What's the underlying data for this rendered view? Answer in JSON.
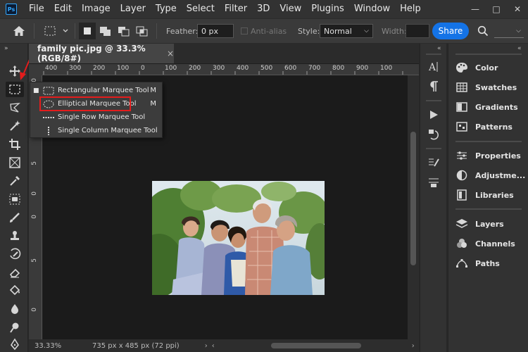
{
  "menubar": {
    "logo": "Ps",
    "items": [
      "File",
      "Edit",
      "Image",
      "Layer",
      "Type",
      "Select",
      "Filter",
      "3D",
      "View",
      "Plugins",
      "Window",
      "Help"
    ]
  },
  "options": {
    "feather_label": "Feather:",
    "feather_value": "0 px",
    "antialias_label": "Anti-alias",
    "style_label": "Style:",
    "style_value": "Normal",
    "width_label": "Width:",
    "share_label": "Share"
  },
  "document": {
    "tab_title": "family pic.jpg @ 33.3% (RGB/8#)",
    "tab_close": "×",
    "ruler_top": [
      "400",
      "300",
      "200",
      "100",
      "0",
      "100",
      "200",
      "300",
      "400",
      "500",
      "600",
      "700",
      "800",
      "900",
      "100"
    ],
    "ruler_left": [
      "0",
      "1",
      "0",
      "5",
      "0",
      "0",
      "5",
      "0"
    ],
    "zoom": "33.33%",
    "doc_info": "735 px x 485 px (72 ppi)"
  },
  "flyout": {
    "items": [
      {
        "label": "Rectangular Marquee Tool",
        "key": "M",
        "icon": "rect-marquee-icon"
      },
      {
        "label": "Elliptical Marquee Tool",
        "key": "M",
        "icon": "ellipse-marquee-icon"
      },
      {
        "label": "Single Row Marquee Tool",
        "key": "",
        "icon": "row-marquee-icon"
      },
      {
        "label": "Single Column Marquee Tool",
        "key": "",
        "icon": "column-marquee-icon"
      }
    ]
  },
  "panels": {
    "group1": [
      "Color",
      "Swatches",
      "Gradients",
      "Patterns"
    ],
    "group2": [
      "Properties",
      "Adjustme...",
      "Libraries"
    ],
    "group3": [
      "Layers",
      "Channels",
      "Paths"
    ]
  },
  "colors": {
    "accent": "#1473e6",
    "highlight": "#e41c1c"
  }
}
